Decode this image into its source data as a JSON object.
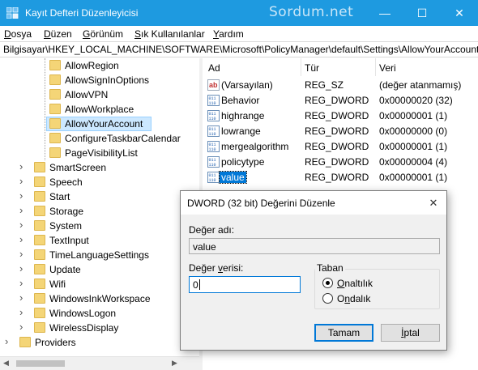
{
  "window": {
    "title": "Kayıt Defteri Düzenleyicisi",
    "watermark": "Sordum.net",
    "controls": {
      "minimize": "—",
      "maximize": "☐",
      "close": "✕"
    },
    "colors": {
      "titlebar": "#1e9ae0",
      "selection": "#0078d7"
    }
  },
  "menu": {
    "file_u": "D",
    "file_rest": "osya",
    "edit_u": "D",
    "edit_rest": "üzen",
    "view_u": "G",
    "view_rest": "örünüm",
    "fav_u": "S",
    "fav_rest": "ık Kullanılanlar",
    "help_u": "Y",
    "help_rest": "ardım"
  },
  "address": "Bilgisayar\\HKEY_LOCAL_MACHINE\\SOFTWARE\\Microsoft\\PolicyManager\\default\\Settings\\AllowYourAccount",
  "tree": {
    "items": [
      {
        "label": "AllowRegion",
        "level": 2,
        "icon": "folder-icon"
      },
      {
        "label": "AllowSignInOptions",
        "level": 2,
        "icon": "folder-icon"
      },
      {
        "label": "AllowVPN",
        "level": 2,
        "icon": "folder-icon"
      },
      {
        "label": "AllowWorkplace",
        "level": 2,
        "icon": "folder-icon"
      },
      {
        "label": "AllowYourAccount",
        "level": 2,
        "icon": "folder-icon",
        "selected": true
      },
      {
        "label": "ConfigureTaskbarCalendar",
        "level": 2,
        "icon": "folder-icon"
      },
      {
        "label": "PageVisibilityList",
        "level": 2,
        "icon": "folder-icon"
      },
      {
        "label": "SmartScreen",
        "level": 1,
        "expandable": true,
        "icon": "folder-icon"
      },
      {
        "label": "Speech",
        "level": 1,
        "expandable": true,
        "icon": "folder-icon"
      },
      {
        "label": "Start",
        "level": 1,
        "expandable": true,
        "icon": "folder-icon"
      },
      {
        "label": "Storage",
        "level": 1,
        "expandable": true,
        "icon": "folder-icon"
      },
      {
        "label": "System",
        "level": 1,
        "expandable": true,
        "icon": "folder-icon"
      },
      {
        "label": "TextInput",
        "level": 1,
        "expandable": true,
        "icon": "folder-icon"
      },
      {
        "label": "TimeLanguageSettings",
        "level": 1,
        "expandable": true,
        "icon": "folder-icon"
      },
      {
        "label": "Update",
        "level": 1,
        "expandable": true,
        "icon": "folder-icon"
      },
      {
        "label": "Wifi",
        "level": 1,
        "expandable": true,
        "icon": "folder-icon"
      },
      {
        "label": "WindowsInkWorkspace",
        "level": 1,
        "expandable": true,
        "icon": "folder-icon"
      },
      {
        "label": "WindowsLogon",
        "level": 1,
        "expandable": true,
        "icon": "folder-icon"
      },
      {
        "label": "WirelessDisplay",
        "level": 1,
        "expandable": true,
        "icon": "folder-icon"
      },
      {
        "label": "Providers",
        "level": 0,
        "expandable": true,
        "icon": "folder-icon"
      }
    ]
  },
  "values": {
    "columns": {
      "name": "Ad",
      "type": "Tür",
      "data": "Veri"
    },
    "rows": [
      {
        "name": "(Varsayılan)",
        "type": "REG_SZ",
        "data": "(değer atanmamış)",
        "icon": "string-value-icon"
      },
      {
        "name": "Behavior",
        "type": "REG_DWORD",
        "data": "0x00000020 (32)",
        "icon": "binary-value-icon"
      },
      {
        "name": "highrange",
        "type": "REG_DWORD",
        "data": "0x00000001 (1)",
        "icon": "binary-value-icon"
      },
      {
        "name": "lowrange",
        "type": "REG_DWORD",
        "data": "0x00000000 (0)",
        "icon": "binary-value-icon"
      },
      {
        "name": "mergealgorithm",
        "type": "REG_DWORD",
        "data": "0x00000001 (1)",
        "icon": "binary-value-icon"
      },
      {
        "name": "policytype",
        "type": "REG_DWORD",
        "data": "0x00000004 (4)",
        "icon": "binary-value-icon"
      },
      {
        "name": "value",
        "type": "REG_DWORD",
        "data": "0x00000001 (1)",
        "icon": "binary-value-icon",
        "selected": true
      }
    ]
  },
  "dialog": {
    "title": "DWORD (32 bit) Değerini Düzenle",
    "close": "✕",
    "name_label": "Değer adı:",
    "name_value": "value",
    "data_label_pre": "Değer ",
    "data_label_u": "v",
    "data_label_post": "erisi:",
    "data_value": "0",
    "base_title": "Taban",
    "hex_u": "O",
    "hex_rest": "naltılık",
    "dec_pre": "O",
    "dec_u": "n",
    "dec_rest": "dalık",
    "selected_base": "hex",
    "ok": "Tamam",
    "cancel_u": "İ",
    "cancel_rest": "ptal"
  }
}
